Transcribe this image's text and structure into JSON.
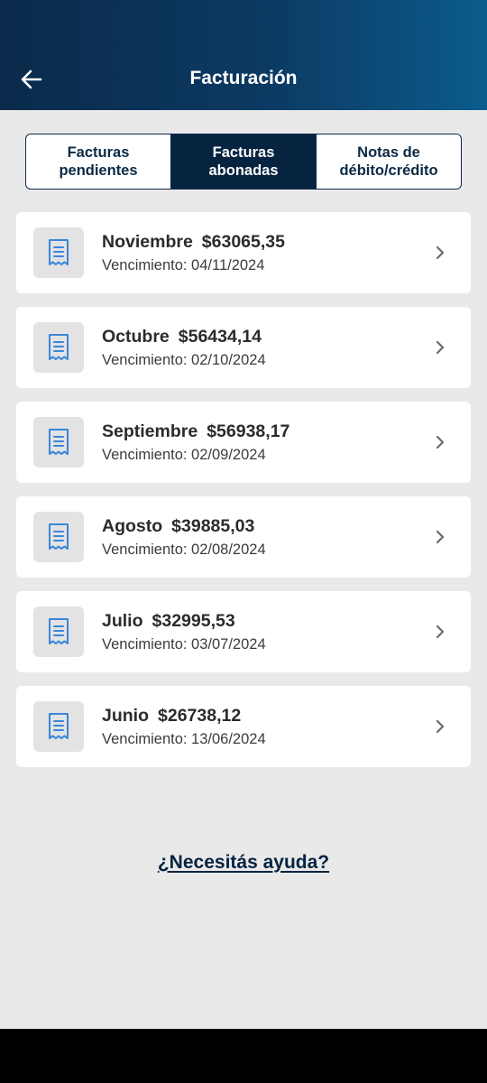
{
  "header": {
    "title": "Facturación",
    "back_icon": "arrow-left-icon"
  },
  "tabs": [
    {
      "label": "Facturas\npendientes",
      "active": false
    },
    {
      "label": "Facturas\nabonadas",
      "active": true
    },
    {
      "label": "Notas de\ndébito/crédito",
      "active": false
    }
  ],
  "invoices": [
    {
      "month": "Noviembre",
      "amount": "$63065,35",
      "due": "Vencimiento: 04/11/2024"
    },
    {
      "month": "Octubre",
      "amount": "$56434,14",
      "due": "Vencimiento: 02/10/2024"
    },
    {
      "month": "Septiembre",
      "amount": "$56938,17",
      "due": "Vencimiento: 02/09/2024"
    },
    {
      "month": "Agosto",
      "amount": "$39885,03",
      "due": "Vencimiento: 02/08/2024"
    },
    {
      "month": "Julio",
      "amount": "$32995,53",
      "due": "Vencimiento: 03/07/2024"
    },
    {
      "month": "Junio",
      "amount": "$26738,12",
      "due": "Vencimiento: 13/06/2024"
    }
  ],
  "help": {
    "label": "¿Necesitás ayuda?"
  },
  "colors": {
    "header_start": "#0a2a4a",
    "header_end": "#0b5c8c",
    "active_tab": "#062340",
    "receipt_icon": "#3a86d9",
    "background": "#e9e9ea"
  }
}
